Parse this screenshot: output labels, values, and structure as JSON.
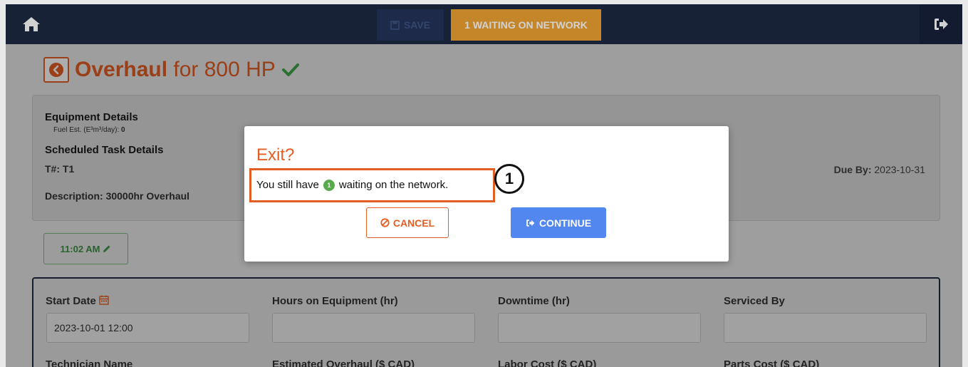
{
  "topbar": {
    "save_label": "SAVE",
    "waiting_label": "1 WAITING ON NETWORK"
  },
  "page": {
    "title_bold": "Overhaul",
    "title_rest": " for 800 HP"
  },
  "details": {
    "equipment_heading": "Equipment Details",
    "fuel_label": "Fuel Est. (E³m³/day): ",
    "fuel_value": "0",
    "task_heading": "Scheduled Task Details",
    "task_number": "T#: T1",
    "description": "Description: 30000hr Overhaul",
    "due_by_label": "Due By: ",
    "due_by_value": "2023-10-31"
  },
  "time_button": {
    "label": "11:02 AM"
  },
  "form": {
    "start_date_label": "Start Date",
    "start_date_value": "2023-10-01 12:00",
    "hours_label": "Hours on Equipment (hr)",
    "downtime_label": "Downtime (hr)",
    "serviced_by_label": "Serviced By",
    "technician_label": "Technician Name",
    "estimated_label": "Estimated Overhaul ($ CAD)",
    "labor_label": "Labor Cost ($ CAD)",
    "parts_label": "Parts Cost ($ CAD)"
  },
  "modal": {
    "title": "Exit?",
    "msg_before": "You still have",
    "badge_count": "1",
    "msg_after": "waiting on the network.",
    "callout_number": "1",
    "cancel_label": "CANCEL",
    "continue_label": "CONTINUE"
  },
  "colors": {
    "accent_orange": "#e35e22",
    "primary_blue": "#5287ef",
    "success_green": "#57ab4c",
    "navbar": "#1e2a44",
    "warning": "#f0a433"
  }
}
